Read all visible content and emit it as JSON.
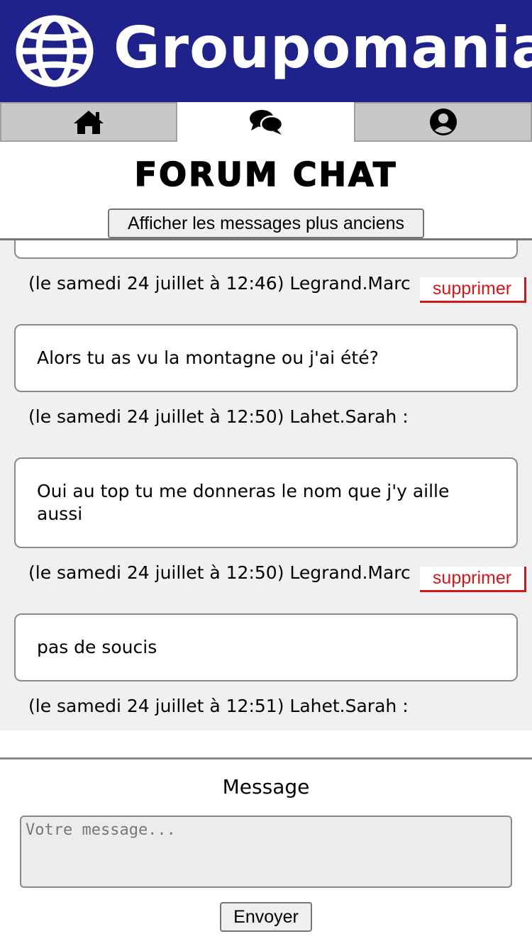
{
  "header": {
    "brand": "Groupomania",
    "logo_icon": "globe-icon",
    "background_color": "#20228c"
  },
  "nav": {
    "tabs": [
      {
        "icon": "home-icon",
        "active": false
      },
      {
        "icon": "chat-icon",
        "active": true
      },
      {
        "icon": "user-circle-icon",
        "active": false
      }
    ]
  },
  "page": {
    "title": "FORUM CHAT",
    "older_button_label": "Afficher les messages plus anciens"
  },
  "messages": [
    {
      "text": "",
      "meta": "(le samedi 24 juillet à 12:46) Legrand.Marc",
      "deletable": true
    },
    {
      "text": "Alors tu as vu la montagne ou j'ai été?",
      "meta": "(le samedi 24 juillet à 12:50) Lahet.Sarah :",
      "deletable": false
    },
    {
      "text": "Oui au top tu me donneras le nom que j'y aille aussi",
      "meta": "(le samedi 24 juillet à 12:50) Legrand.Marc",
      "deletable": true
    },
    {
      "text": "pas de soucis",
      "meta": "(le samedi 24 juillet à 12:51) Lahet.Sarah :",
      "deletable": false
    }
  ],
  "delete_label": "supprimer",
  "delete_color": "#d01818",
  "compose": {
    "label": "Message",
    "placeholder": "Votre message...",
    "send_label": "Envoyer"
  }
}
